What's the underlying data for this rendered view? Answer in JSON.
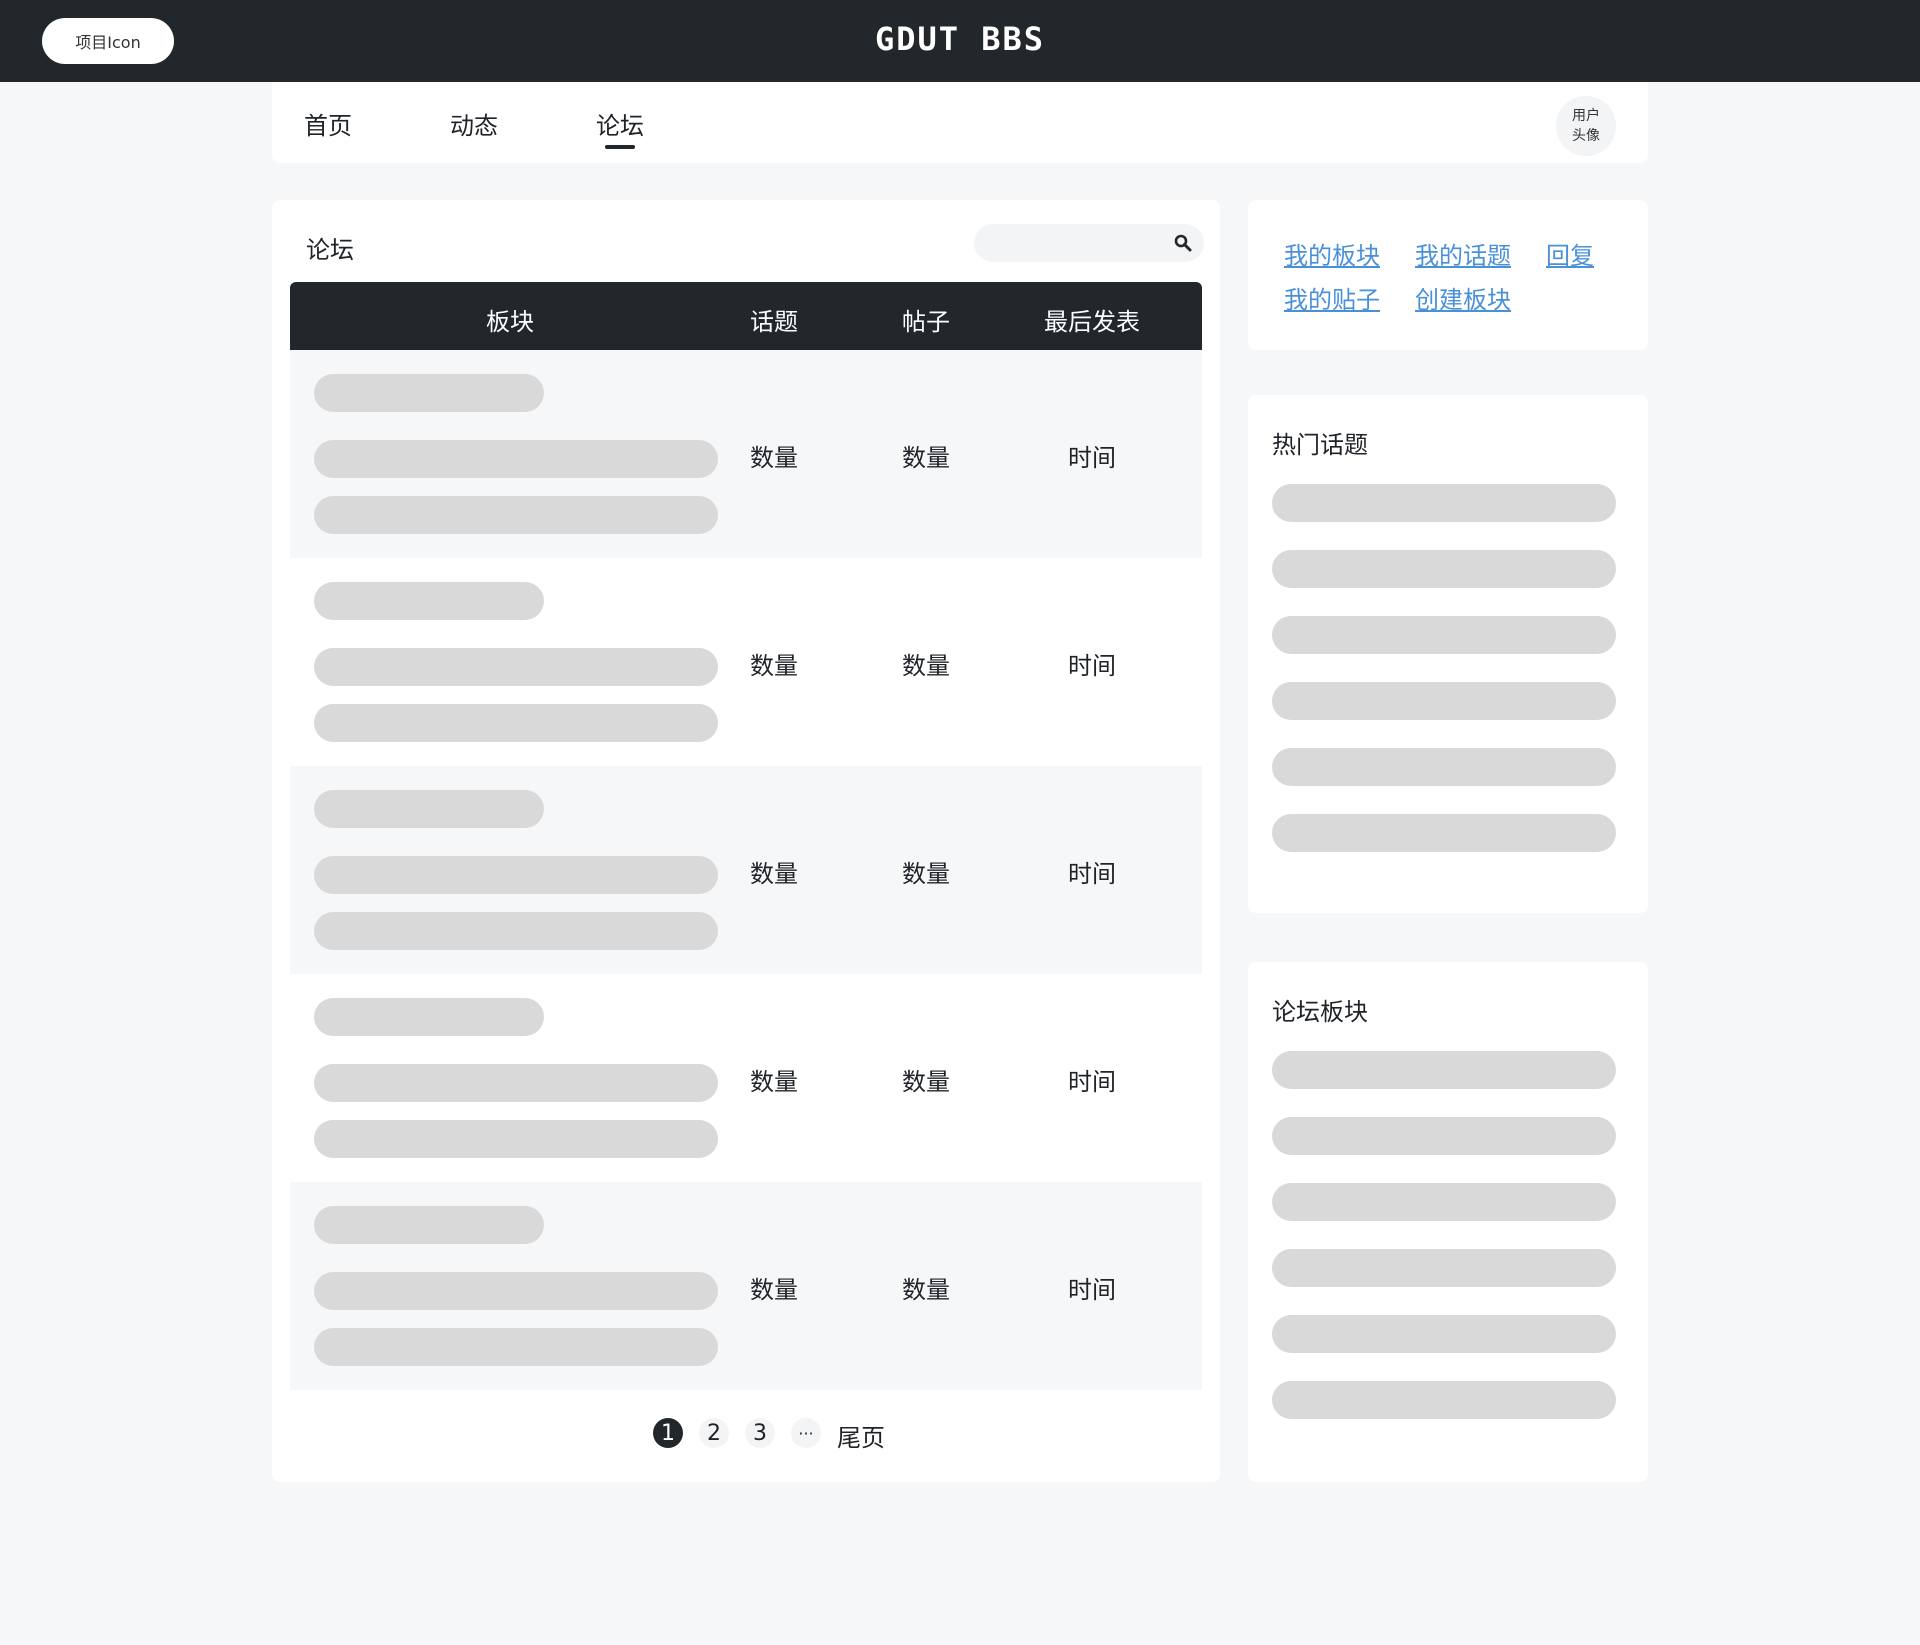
{
  "header": {
    "logo_label": "项目Icon",
    "site_title": "GDUT BBS"
  },
  "nav": {
    "items": [
      {
        "label": "首页"
      },
      {
        "label": "动态"
      },
      {
        "label": "论坛"
      }
    ],
    "active": "论坛",
    "avatar_label": "用户头像"
  },
  "forum": {
    "title": "论坛",
    "search": {
      "value": "",
      "placeholder": ""
    },
    "columns": [
      "板块",
      "话题",
      "帖子",
      "最后发表"
    ],
    "rows": [
      {
        "topics": "数量",
        "posts": "数量",
        "last_post": "时间"
      },
      {
        "topics": "数量",
        "posts": "数量",
        "last_post": "时间"
      },
      {
        "topics": "数量",
        "posts": "数量",
        "last_post": "时间"
      },
      {
        "topics": "数量",
        "posts": "数量",
        "last_post": "时间"
      },
      {
        "topics": "数量",
        "posts": "数量",
        "last_post": "时间"
      }
    ],
    "pagination": {
      "pages": [
        "1",
        "2",
        "3"
      ],
      "current": "1",
      "ellipsis": "···",
      "last_label": "尾页"
    }
  },
  "quick_links": [
    "我的板块",
    "我的话题",
    "回复",
    "我的贴子",
    "创建板块"
  ],
  "hot_topics": {
    "title": "热门话题"
  },
  "forum_boards": {
    "title": "论坛板块"
  },
  "colors": {
    "topbar": "#22272c",
    "page_background": "#f6f7f9",
    "link": "#4a90d9",
    "skeleton": "#d9d9d9"
  }
}
